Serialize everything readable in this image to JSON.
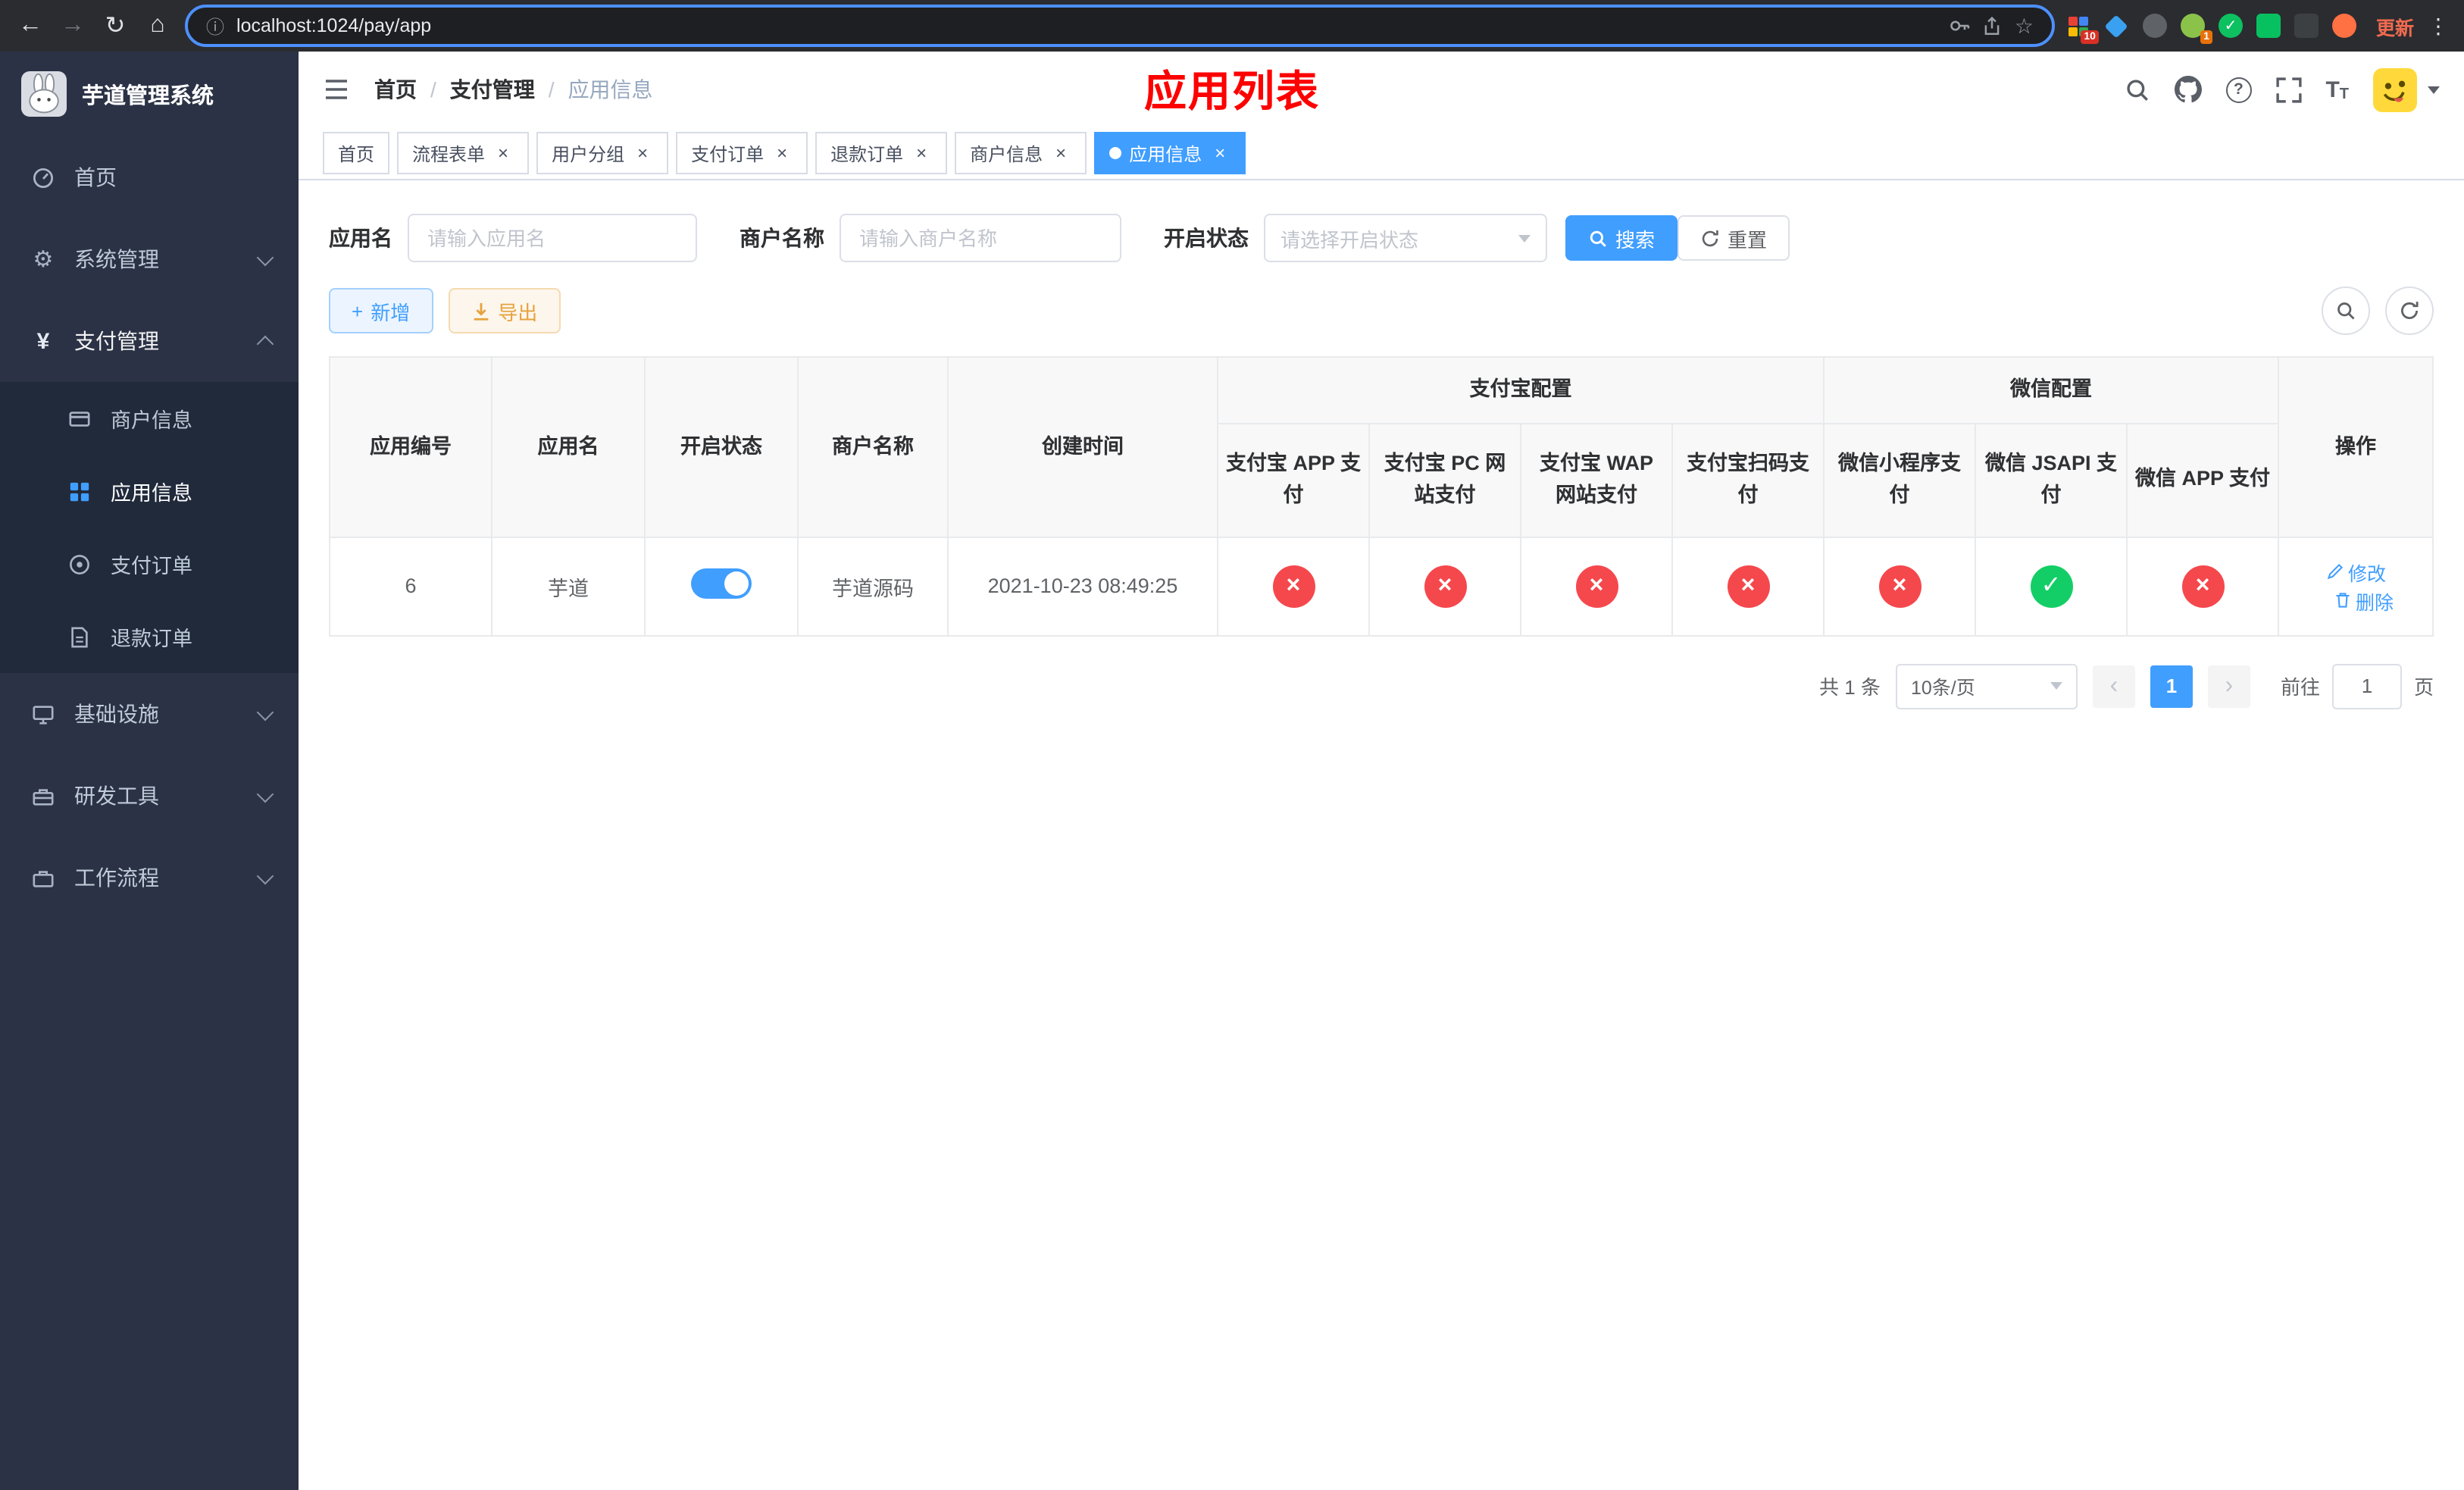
{
  "colors": {
    "primary": "#409eff",
    "success": "#13ce66",
    "danger": "#f5484d",
    "warning": "#e6a23c",
    "annotation_red": "#fd0100",
    "sidebar_bg": "#2b3245"
  },
  "icons": {
    "back": "←",
    "forward": "→",
    "reload": "↻",
    "home": "⌂",
    "info": "ⓘ",
    "star": "☆",
    "menu_dots": "⋮",
    "gear": "⚙",
    "yen": "¥",
    "plus": "+",
    "close": "×",
    "cross": "×",
    "check": "✓",
    "question": "?",
    "prev": "‹",
    "next": "›",
    "letter_T": "T"
  },
  "browser": {
    "url": "localhost:1024/pay/app",
    "update_label": "更新",
    "extensions_badge": "10",
    "avatar_badge": "1"
  },
  "sidebar": {
    "title": "芋道管理系统",
    "items": [
      {
        "label": "首页"
      },
      {
        "label": "系统管理"
      },
      {
        "label": "支付管理",
        "children": [
          {
            "label": "商户信息"
          },
          {
            "label": "应用信息"
          },
          {
            "label": "支付订单"
          },
          {
            "label": "退款订单"
          }
        ]
      },
      {
        "label": "基础设施"
      },
      {
        "label": "研发工具"
      },
      {
        "label": "工作流程"
      }
    ]
  },
  "header": {
    "breadcrumb": [
      "首页",
      "支付管理",
      "应用信息"
    ],
    "separator": "/",
    "overlay_title": "应用列表"
  },
  "tabs": [
    {
      "label": "首页"
    },
    {
      "label": "流程表单"
    },
    {
      "label": "用户分组"
    },
    {
      "label": "支付订单"
    },
    {
      "label": "退款订单"
    },
    {
      "label": "商户信息"
    },
    {
      "label": "应用信息"
    }
  ],
  "filters": {
    "app_name_label": "应用名",
    "app_name_placeholder": "请输入应用名",
    "merchant_label": "商户名称",
    "merchant_placeholder": "请输入商户名称",
    "status_label": "开启状态",
    "status_placeholder": "请选择开启状态",
    "search_label": "搜索",
    "reset_label": "重置"
  },
  "toolbar": {
    "add_label": "新增",
    "export_label": "导出"
  },
  "table": {
    "group_headers": {
      "alipay": "支付宝配置",
      "wechat": "微信配置"
    },
    "headers": [
      "应用编号",
      "应用名",
      "开启状态",
      "商户名称",
      "创建时间",
      "操作"
    ],
    "sub_headers": [
      "支付宝 APP 支付",
      "支付宝 PC 网站支付",
      "支付宝 WAP 网站支付",
      "支付宝扫码支付",
      "微信小程序支付",
      "微信 JSAPI 支付",
      "微信 APP 支付"
    ],
    "rows": [
      {
        "app_id": "6",
        "app_name": "芋道",
        "status_enabled": true,
        "merchant_name": "芋道源码",
        "created_at": "2021-10-23 08:49:25",
        "configs": [
          "disabled",
          "disabled",
          "disabled",
          "disabled",
          "disabled",
          "enabled",
          "disabled"
        ],
        "edit_label": "修改",
        "delete_label": "删除"
      }
    ]
  },
  "pagination": {
    "total_text": "共 1 条",
    "page_size_text": "10条/页",
    "current_page": "1",
    "goto_prefix": "前往",
    "goto_value": "1",
    "goto_suffix": "页"
  }
}
